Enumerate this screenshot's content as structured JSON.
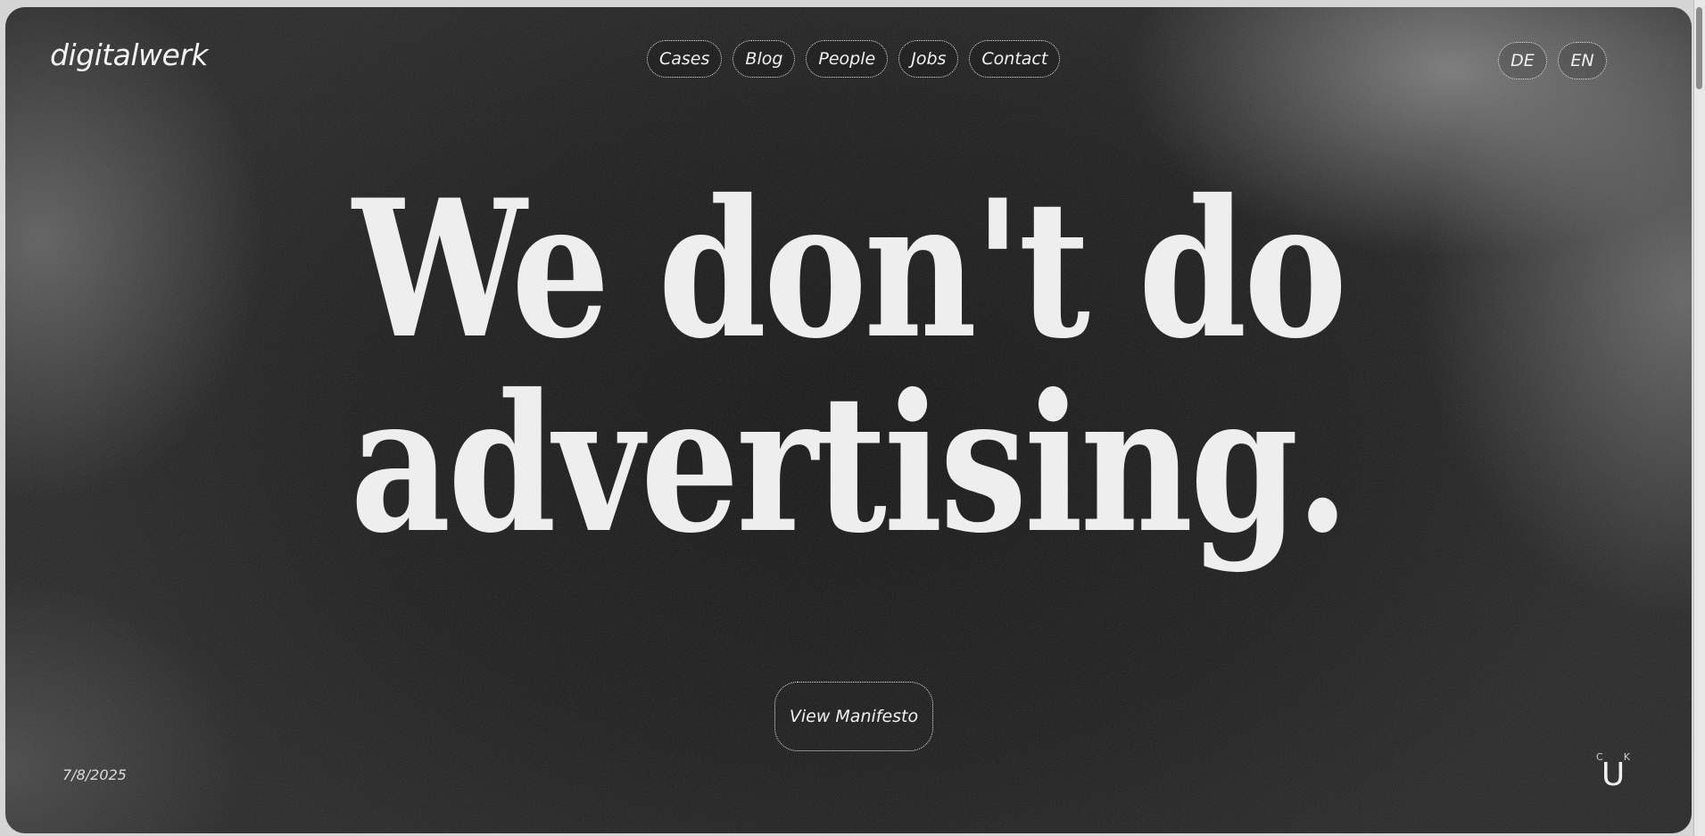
{
  "brand": {
    "logo_text": "digitalwerk"
  },
  "nav": {
    "items": [
      {
        "label": "Cases"
      },
      {
        "label": "Blog"
      },
      {
        "label": "People"
      },
      {
        "label": "Jobs"
      },
      {
        "label": "Contact"
      }
    ]
  },
  "language": {
    "options": [
      {
        "label": "DE"
      },
      {
        "label": "EN"
      }
    ]
  },
  "hero": {
    "headline_line_1": "We don't do",
    "headline_line_2": "advertising.",
    "cta_label": "View Manifesto"
  },
  "footer": {
    "date": "7/8/2025",
    "badge_small_left": "C",
    "badge_small_right": "K",
    "badge_main": "U"
  },
  "colors": {
    "background": "#1b1b1b",
    "text": "#eeeeee"
  },
  "icons": {
    "badge": "cuk-badge-icon"
  }
}
